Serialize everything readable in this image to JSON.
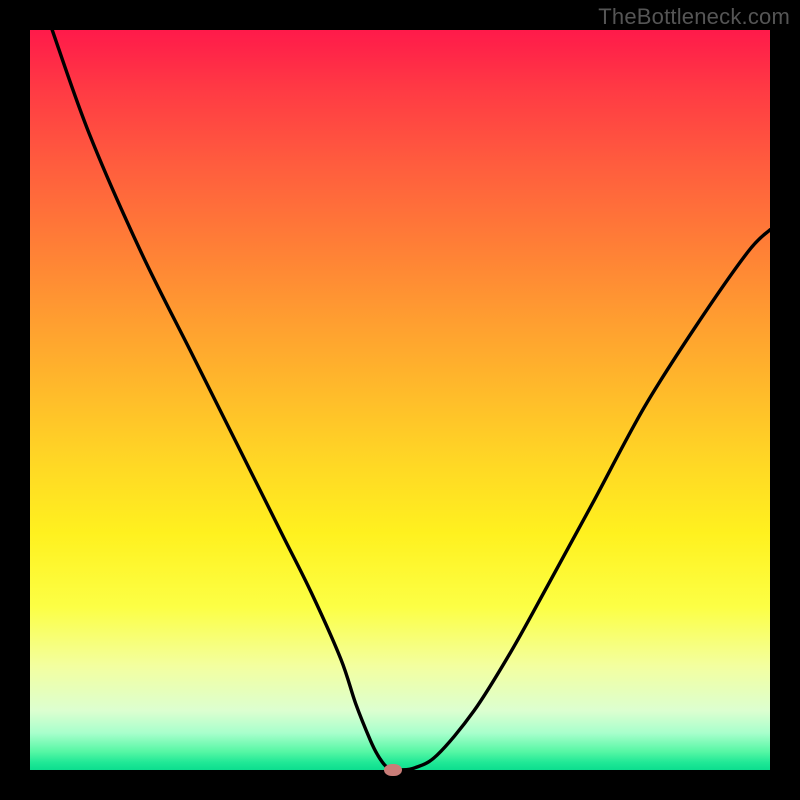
{
  "watermark": "TheBottleneck.com",
  "chart_data": {
    "type": "line",
    "title": "",
    "xlabel": "",
    "ylabel": "",
    "xlim": [
      0,
      100
    ],
    "ylim": [
      0,
      100
    ],
    "grid": false,
    "series": [
      {
        "name": "curve",
        "x": [
          3,
          8,
          15,
          22,
          28,
          34,
          38,
          42,
          44,
          46,
          47,
          48,
          49,
          50,
          52,
          55,
          60,
          65,
          70,
          76,
          83,
          90,
          97,
          100
        ],
        "y": [
          100,
          86,
          70,
          56,
          44,
          32,
          24,
          15,
          9,
          4,
          2,
          0.6,
          0,
          0,
          0.3,
          2,
          8,
          16,
          25,
          36,
          49,
          60,
          70,
          73
        ]
      }
    ],
    "minimum_marker": {
      "x": 49,
      "y": 0
    },
    "gradient_colors": {
      "top": "#ff1a4a",
      "mid": "#ffd625",
      "bottom": "#0cde8f"
    }
  }
}
